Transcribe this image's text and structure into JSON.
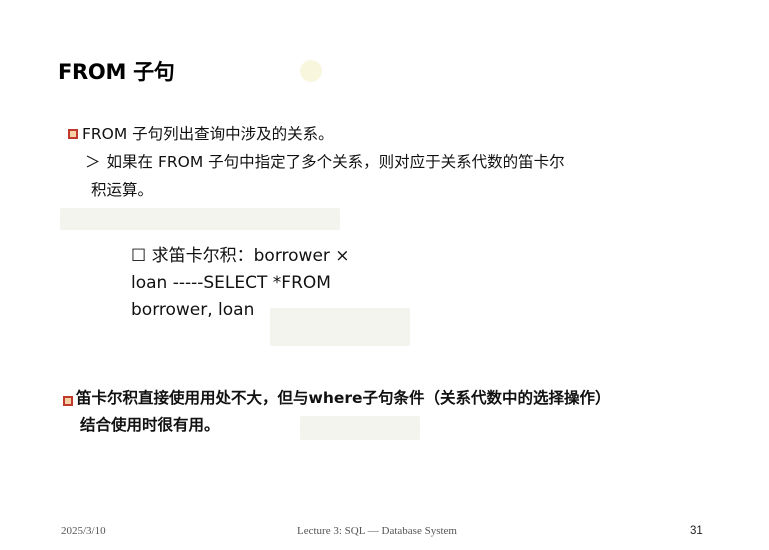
{
  "title": "FROM 子句",
  "bullet1": {
    "line": "FROM 子句列出查询中涉及的关系。",
    "sub_arrow": "＞",
    "sub_line1": "如果在 FROM 子句中指定了多个关系，则对应于关系代数的笛卡尔",
    "sub_line2": "积运算。"
  },
  "example": {
    "line1": "☐ 求笛卡尔积：borrower ×",
    "line2": "loan -----SELECT *FROM",
    "line3": "borrower, loan"
  },
  "bullet2": {
    "line1": "笛卡尔积直接使用用处不大，但与where子句条件（关系代数中的选择操作）",
    "line2": "结合使用时很有用。"
  },
  "footer": {
    "date": "2025/3/10",
    "center": "Lecture 3: SQL — Database System",
    "page": "31"
  },
  "colors": {
    "bullet_border": "#c0392b",
    "bullet_fill": "#f6d1a8"
  }
}
